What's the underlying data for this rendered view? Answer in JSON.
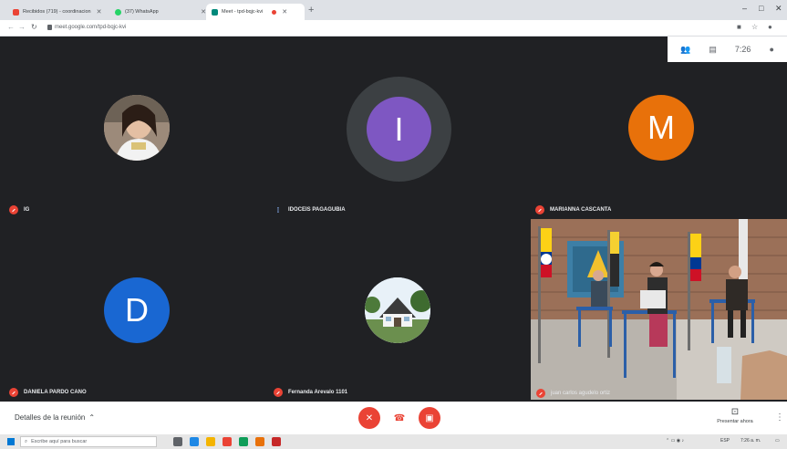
{
  "browser": {
    "tabs": [
      {
        "label": "Recibidos (719) - coordinacion",
        "color": "#ea4335"
      },
      {
        "label": "(37) WhatsApp",
        "color": "#25d366"
      },
      {
        "label": "Meet - tpd-bqjc-kvi",
        "color": "#00897b"
      }
    ],
    "new_tab": "+",
    "window_controls": {
      "minimize": "–",
      "maximize": "□",
      "close": "✕"
    },
    "url": "meet.google.com/tpd-bqjc-kvi"
  },
  "overlay": {
    "time": "7:26"
  },
  "participants": [
    {
      "name": "IG",
      "avatar_kind": "photo",
      "mic": "off"
    },
    {
      "name": "IDOCEIS PAGAGUBIA",
      "avatar_letter": "I",
      "avatar_color": "#7e57c2",
      "mic": "on"
    },
    {
      "name": "MARIANNA CASCANTA",
      "avatar_letter": "M",
      "avatar_color": "#e8710a",
      "mic": "off"
    },
    {
      "name": "DANIELA PARDO CANO",
      "avatar_letter": "D",
      "avatar_color": "#1967d2",
      "mic": "off"
    },
    {
      "name": "Fernanda Arevalo 1101",
      "avatar_kind": "photo",
      "mic": "off"
    },
    {
      "name": "juan carlos agudelo ortiz",
      "avatar_kind": "video",
      "mic": "off"
    }
  ],
  "bottom": {
    "details": "Detalles de la reunión",
    "present": "Presentar ahora"
  },
  "taskbar": {
    "search_placeholder": "Escribe aquí para buscar",
    "lang": "ESP",
    "clock": "7:26 a. m."
  },
  "colors": {
    "meet_bg": "#202124",
    "red": "#ea4335"
  }
}
